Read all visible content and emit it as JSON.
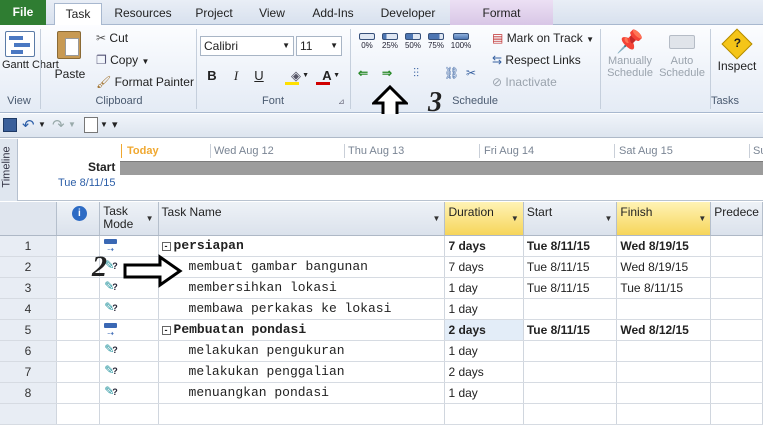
{
  "tabs": {
    "file": "File",
    "task": "Task",
    "resources": "Resources",
    "project": "Project",
    "view": "View",
    "addins": "Add-Ins",
    "developer": "Developer",
    "format": "Format"
  },
  "ribbon": {
    "view": {
      "gantt_chart": "Gantt Chart",
      "group": "View"
    },
    "clipboard": {
      "paste": "Paste",
      "cut": "Cut",
      "copy": "Copy",
      "format_painter": "Format Painter",
      "group": "Clipboard"
    },
    "font": {
      "family": "Calibri",
      "size": "11",
      "bold": "B",
      "italic": "I",
      "underline": "U",
      "group": "Font"
    },
    "schedule": {
      "pcts": [
        "0%",
        "25%",
        "50%",
        "75%",
        "100%"
      ],
      "mark_on_track": "Mark on Track",
      "respect_links": "Respect Links",
      "inactivate": "Inactivate",
      "group": "Schedule"
    },
    "tasks": {
      "manually": "Manually",
      "manually2": "Schedule",
      "auto": "Auto",
      "auto2": "Schedule",
      "inspect": "Inspect",
      "group": "Tasks"
    }
  },
  "annotations": {
    "arrow_ribbon": "3",
    "arrow_grid": "2"
  },
  "timeline": {
    "label": "Timeline",
    "today": "Today",
    "start_label": "Start",
    "start_date": "Tue 8/11/15",
    "dates": [
      "Wed Aug 12",
      "Thu Aug 13",
      "Fri Aug 14",
      "Sat Aug 15",
      "Su"
    ]
  },
  "grid": {
    "headers": {
      "mode": "Task Mode",
      "name": "Task Name",
      "duration": "Duration",
      "start": "Start",
      "finish": "Finish",
      "pred": "Predece"
    },
    "rows": [
      {
        "id": "1",
        "name": "persiapan",
        "duration": "7 days",
        "start": "Tue 8/11/15",
        "finish": "Wed 8/19/15",
        "summary": true,
        "mono": true
      },
      {
        "id": "2",
        "name": "membuat gambar bangunan",
        "duration": "7 days",
        "start": "Tue 8/11/15",
        "finish": "Wed 8/19/15",
        "summary": false,
        "mono": true
      },
      {
        "id": "3",
        "name": "membersihkan lokasi",
        "duration": "1 day",
        "start": "Tue 8/11/15",
        "finish": "Tue 8/11/15",
        "summary": false,
        "mono": true
      },
      {
        "id": "4",
        "name": "membawa perkakas ke lokasi",
        "duration": "1 day",
        "start": "",
        "finish": "",
        "summary": false,
        "mono": true
      },
      {
        "id": "5",
        "name": "Pembuatan pondasi",
        "duration": "2 days",
        "start": "Tue 8/11/15",
        "finish": "Wed 8/12/15",
        "summary": true,
        "mono": true
      },
      {
        "id": "6",
        "name": "melakukan pengukuran",
        "duration": "1 day",
        "start": "",
        "finish": "",
        "summary": false,
        "mono": true
      },
      {
        "id": "7",
        "name": "melakukan penggalian",
        "duration": "2 days",
        "start": "",
        "finish": "",
        "summary": false,
        "mono": true
      },
      {
        "id": "8",
        "name": "menuangkan pondasi",
        "duration": "1 day",
        "start": "",
        "finish": "",
        "summary": false,
        "mono": true
      }
    ]
  }
}
